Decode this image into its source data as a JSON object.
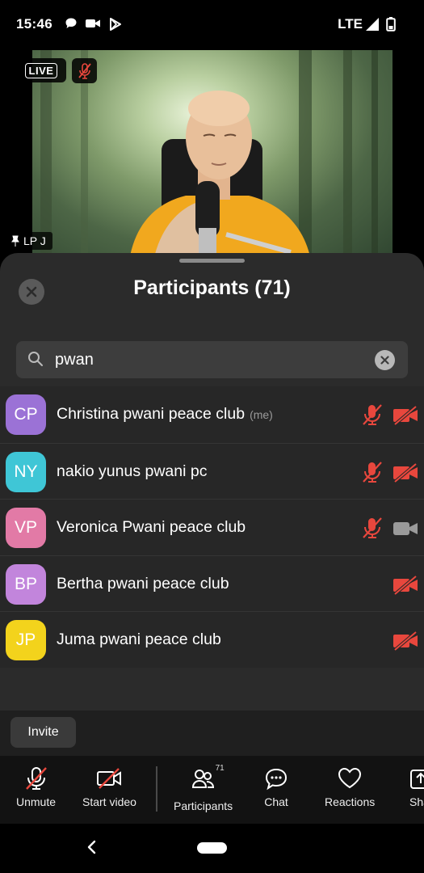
{
  "status_bar": {
    "time": "15:46",
    "network": "LTE",
    "icons": [
      "chat-bubble-icon",
      "video-camera-icon",
      "play-store-icon",
      "signal-icon",
      "battery-icon"
    ]
  },
  "video": {
    "live_label": "LIVE",
    "speaker_name": "LP J"
  },
  "sheet": {
    "title": "Participants (71)"
  },
  "search": {
    "value": "pwan"
  },
  "participants": [
    {
      "initials": "CP",
      "name": "Christina pwani peace club",
      "me_tag": "(me)",
      "color": "#9b72d6",
      "mic_muted": true,
      "video_off": true
    },
    {
      "initials": "NY",
      "name": "nakio yunus pwani pc",
      "color": "#3fc6d6",
      "mic_muted": true,
      "video_off": true
    },
    {
      "initials": "VP",
      "name": "Veronica Pwani peace club",
      "color": "#e27aa6",
      "mic_muted": true,
      "video_off": false
    },
    {
      "initials": "BP",
      "name": "Bertha pwani peace club",
      "color": "#c285dc",
      "mic_muted": null,
      "video_off": true
    },
    {
      "initials": "JP",
      "name": "Juma pwani peace club",
      "color": "#f3d31c",
      "mic_muted": null,
      "video_off": true
    }
  ],
  "invite_label": "Invite",
  "toolbar": {
    "unmute": "Unmute",
    "start_video": "Start video",
    "participants": "Participants",
    "participants_count": "71",
    "chat": "Chat",
    "reactions": "Reactions",
    "share": "Sha"
  },
  "colors": {
    "muted_red": "#e8473d",
    "sheet_bg": "#2b2b2b"
  }
}
